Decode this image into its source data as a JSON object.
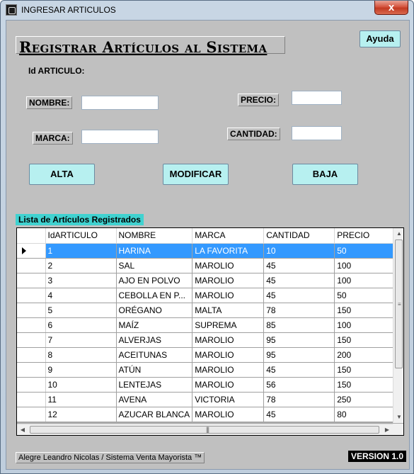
{
  "window": {
    "title": "INGRESAR ARTICULOS",
    "close_label": "x"
  },
  "header": {
    "title": "Registrar Artículos al Sistema",
    "help_label": "Ayuda"
  },
  "form": {
    "id_label": "Id ARTICULO:",
    "nombre_label": "NOMBRE:",
    "marca_label": "MARCA:",
    "precio_label": "PRECIO:",
    "cantidad_label": "CANTIDAD:",
    "nombre_value": "",
    "marca_value": "",
    "precio_value": "",
    "cantidad_value": ""
  },
  "actions": {
    "alta": "ALTA",
    "modificar": "MODIFICAR",
    "baja": "BAJA"
  },
  "list": {
    "title": "Lista de Artículos Registrados",
    "columns": [
      "IdARTICULO",
      "NOMBRE",
      "MARCA",
      "CANTIDAD",
      "PRECIO"
    ],
    "selected_row": 0,
    "rows": [
      [
        "1",
        "HARINA",
        "LA FAVORITA",
        "10",
        "50"
      ],
      [
        "2",
        "SAL",
        "MAROLIO",
        "45",
        "100"
      ],
      [
        "3",
        "AJO EN POLVO",
        "MAROLIO",
        "45",
        "100"
      ],
      [
        "4",
        "CEBOLLA EN P...",
        "MAROLIO",
        "45",
        "50"
      ],
      [
        "5",
        "ORÉGANO",
        "MALTA",
        "78",
        "150"
      ],
      [
        "6",
        "MAÍZ",
        "SUPREMA",
        "85",
        "100"
      ],
      [
        "7",
        "ALVERJAS",
        "MAROLIO",
        "95",
        "150"
      ],
      [
        "8",
        "ACEITUNAS",
        "MAROLIO",
        "95",
        "200"
      ],
      [
        "9",
        "ATÚN",
        "MAROLIO",
        "45",
        "150"
      ],
      [
        "10",
        "LENTEJAS",
        "MAROLIO",
        "56",
        "150"
      ],
      [
        "11",
        "AVENA",
        "VICTORIA",
        "78",
        "250"
      ],
      [
        "12",
        "AZUCAR BLANCA",
        "MAROLIO",
        "45",
        "80"
      ]
    ]
  },
  "footer": {
    "credit": "Alegre Leandro Nicolas / Sistema Venta Mayorista ™",
    "version": "VERSION 1.0"
  },
  "colors": {
    "button_bg": "#b7f0f0",
    "selection": "#3399ff",
    "section_label": "#40d2d0",
    "form_bg": "#c0c0c0"
  }
}
